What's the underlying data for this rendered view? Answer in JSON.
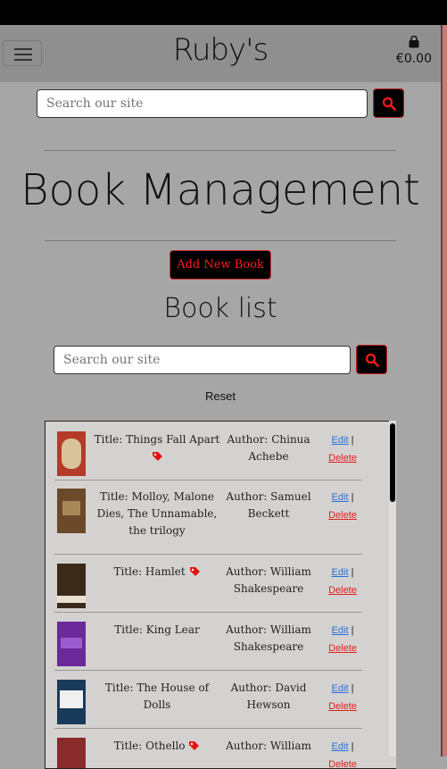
{
  "brand": "Ruby's",
  "cart": {
    "total": "€0.00",
    "icon": "shopping-bag-icon"
  },
  "top_search": {
    "placeholder": "Search our site"
  },
  "page_title": "Book Management",
  "add_button_label": "Add New Book",
  "list_title": "Book list",
  "list_search": {
    "placeholder": "Search our site"
  },
  "reset_label": "Reset",
  "colors": {
    "accent": "#ff1a1a",
    "link": "#2b6fd6",
    "background": "#a6a6a6"
  },
  "books": [
    {
      "title": "Title: Things Fall Apart",
      "author": "Author: Chinua Achebe",
      "sale": true,
      "cover": "#b43a2a",
      "edit": "Edit",
      "delete": "Delete"
    },
    {
      "title": "Title: Molloy, Malone Dies, The Unnamable, the trilogy",
      "author": "Author: Samuel Beckett",
      "sale": false,
      "cover": "#6a4a2a",
      "edit": "Edit",
      "delete": "Delete"
    },
    {
      "title": "Title: Hamlet",
      "author": "Author: William Shakespeare",
      "sale": true,
      "cover": "#3a2a1a",
      "edit": "Edit",
      "delete": "Delete"
    },
    {
      "title": "Title: King Lear",
      "author": "Author: William Shakespeare",
      "sale": false,
      "cover": "#6a2a9a",
      "edit": "Edit",
      "delete": "Delete"
    },
    {
      "title": "Title: The House of Dolls",
      "author": "Author: David Hewson",
      "sale": false,
      "cover": "#1a3a5a",
      "edit": "Edit",
      "delete": "Delete"
    },
    {
      "title": "Title: Othello",
      "author": "Author: William",
      "sale": true,
      "cover": "#8a2a2a",
      "edit": "Edit",
      "delete": "Delete"
    }
  ]
}
